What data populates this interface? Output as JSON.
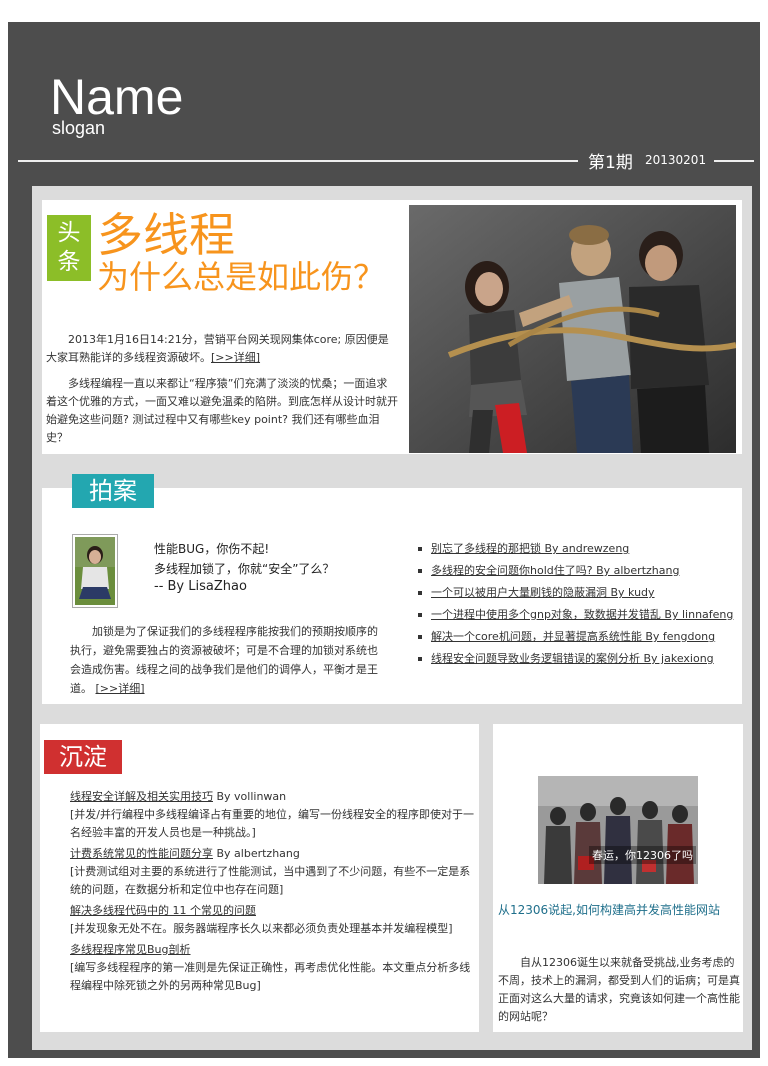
{
  "header": {
    "name": "Name",
    "slogan": "slogan",
    "issue": "第1期",
    "issue_date": "20130201"
  },
  "headline": {
    "tag": "头条",
    "title": "多线程",
    "subtitle": "为什么总是如此伤？",
    "para1": "2013年1月16日14:21分，营销平台网关现网集体core; 原因便是大家耳熟能详的多线程资源破坏。",
    "more_link": "[>>详细]",
    "para2": "多线程编程一直以来都让“程序猿”们充满了淡淡的忧桑；一面追求着这个优雅的方式，一面又难以避免温柔的陷阱。到底怎样从设计时就开始避免这些问题? 测试过程中又有哪些key point? 我们还有哪些血泪史？"
  },
  "case": {
    "tag": "拍案",
    "title_line1": "性能BUG，你伤不起!",
    "title_line2": "多线程加锁了，你就“安全”了么？",
    "byline": "-- By LisaZhao",
    "body": "加锁是为了保证我们的多线程程序能按我们的预期按顺序的执行，避免需要独占的资源被破坏；可是不合理的加锁对系统也会造成伤害。线程之间的战争我们是他们的调停人，平衡才是王道。",
    "more_link": "[>>详细]",
    "list": [
      "别忘了多线程的那把锁 By andrewzeng",
      "多线程的安全问题你hold住了吗? By albertzhang",
      "一个可以被用户大量刷钱的隐蔽漏洞 By kudy",
      "一个进程中使用多个gnp对象，致数据并发错乱 By linnafeng",
      "解决一个core机问题，并显著提高系统性能 By fengdong",
      "线程安全问题导致业务逻辑错误的案例分析 By jakexiong"
    ]
  },
  "sediment": {
    "tag": "沉淀",
    "items": [
      {
        "title": "线程安全详解及相关实用技巧",
        "author": " By vollinwan",
        "desc": "[并发/并行编程中多线程编译占有重要的地位，编写一份线程安全的程序即使对于一名经验丰富的开发人员也是一种挑战。]"
      },
      {
        "title": "计费系统常见的性能问题分享",
        "author": " By albertzhang",
        "desc": "[计费测试组对主要的系统进行了性能测试，当中遇到了不少问题，有些不一定是系统的问题，在数据分析和定位中也存在问题]"
      },
      {
        "title": "解决多线程代码中的 11 个常见的问题",
        "author": "",
        "desc": "[并发现象无处不在。服务器端程序长久以来都必须负责处理基本并发编程模型]"
      },
      {
        "title": "多线程程序常见Bug剖析",
        "author": "",
        "desc": "[编写多线程程序的第一准则是先保证正确性，再考虑优化性能。本文重点分析多线程编程中除死锁之外的另两种常见Bug]"
      }
    ]
  },
  "side": {
    "photo_caption": "春运，你12306了吗",
    "title": "从12306说起,如何构建高并发高性能网站",
    "body": "自从12306诞生以来就备受挑战,业务考虑的不周，技术上的漏洞，都受到人们的诟病；可是真正面对这么大量的请求，究竟该如何建一个高性能的网站呢？"
  },
  "colors": {
    "frame": "#4d4d4d",
    "headline_orange": "#f7941d",
    "tag_green": "#8cbe28",
    "tag_teal": "#23a7b0",
    "tag_red": "#d03030",
    "side_title_blue": "#1f6f8b"
  }
}
